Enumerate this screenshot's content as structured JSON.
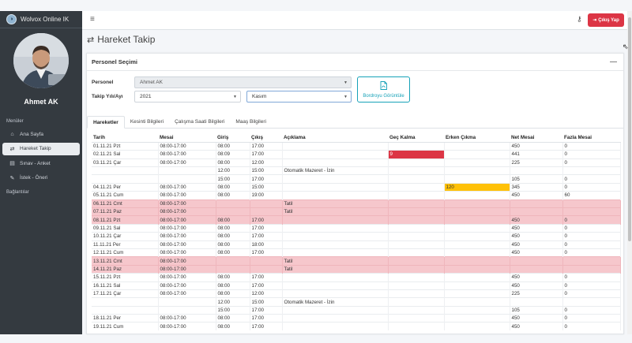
{
  "brand": {
    "name": "Wolvox Online IK"
  },
  "user": {
    "name": "Ahmet AK"
  },
  "sidebar": {
    "menu_label": "Menüler",
    "items": [
      {
        "label": "Ana Sayfa",
        "icon": "home-icon"
      },
      {
        "label": "Hareket Takip",
        "icon": "exchange-icon"
      },
      {
        "label": "Sınav - Anket",
        "icon": "list-icon"
      },
      {
        "label": "İstek - Öneri",
        "icon": "edit-icon"
      }
    ],
    "links_label": "Bağlantılar"
  },
  "topbar": {
    "logout_label": "Çıkış Yap"
  },
  "page": {
    "title": "Hareket Takip"
  },
  "card": {
    "title": "Personel Seçimi",
    "personel_label": "Personel",
    "personel_value": "Ahmet AK",
    "period_label": "Takip Yılı/Ayı",
    "year_value": "2021",
    "month_value": "Kasım",
    "bordro_label": "Bordroyu Görüntüle"
  },
  "tabs": [
    "Hareketler",
    "Kesinti Bilgileri",
    "Çalışma Saati Bilgileri",
    "Maaş Bilgileri"
  ],
  "table": {
    "headers": [
      "Tarih",
      "Mesai",
      "Giriş",
      "Çıkış",
      "Açıklama",
      "Geç Kalma",
      "Erken Çıkma",
      "Net Mesai",
      "Fazla Mesai"
    ],
    "rows": [
      [
        "01.11.21 Pzt",
        "08:00-17:00",
        "08:00",
        "17:00",
        "",
        "",
        "",
        "450",
        "0"
      ],
      [
        "02.11.21 Sal",
        "08:00-17:00",
        "08:09",
        "17:00",
        "",
        "9",
        "",
        "441",
        "0"
      ],
      [
        "03.11.21 Çar",
        "08:00-17:00",
        "08:00",
        "12:00",
        "",
        "",
        "",
        "225",
        "0"
      ],
      [
        "",
        "",
        "12:00",
        "15:00",
        "Otomatik Mazeret - İzin",
        "",
        "",
        "",
        ""
      ],
      [
        "",
        "",
        "15:00",
        "17:00",
        "",
        "",
        "",
        "105",
        "0"
      ],
      [
        "04.11.21 Per",
        "08:00-17:00",
        "08:00",
        "15:00",
        "",
        "",
        "120",
        "345",
        "0"
      ],
      [
        "05.11.21 Cum",
        "08:00-17:00",
        "08:00",
        "19:00",
        "",
        "",
        "",
        "450",
        "60"
      ],
      [
        "06.11.21 Cmt",
        "08:00-17:00",
        "",
        "",
        "Tatil",
        "",
        "",
        "",
        ""
      ],
      [
        "07.11.21 Paz",
        "08:00-17:00",
        "",
        "",
        "Tatil",
        "",
        "",
        "",
        ""
      ],
      [
        "08.11.21 Pzt",
        "08:00-17:00",
        "08:00",
        "17:00",
        "",
        "",
        "",
        "450",
        "0"
      ],
      [
        "09.11.21 Sal",
        "08:00-17:00",
        "08:00",
        "17:00",
        "",
        "",
        "",
        "450",
        "0"
      ],
      [
        "10.11.21 Çar",
        "08:00-17:00",
        "08:00",
        "17:00",
        "",
        "",
        "",
        "450",
        "0"
      ],
      [
        "11.11.21 Per",
        "08:00-17:00",
        "08:00",
        "18:00",
        "",
        "",
        "",
        "450",
        "0"
      ],
      [
        "12.11.21 Cum",
        "08:00-17:00",
        "08:00",
        "17:00",
        "",
        "",
        "",
        "450",
        "0"
      ],
      [
        "13.11.21 Cmt",
        "08:00-17:00",
        "",
        "",
        "Tatil",
        "",
        "",
        "",
        ""
      ],
      [
        "14.11.21 Paz",
        "08:00-17:00",
        "",
        "",
        "Tatil",
        "",
        "",
        "",
        ""
      ],
      [
        "15.11.21 Pzt",
        "08:00-17:00",
        "08:00",
        "17:00",
        "",
        "",
        "",
        "450",
        "0"
      ],
      [
        "16.11.21 Sal",
        "08:00-17:00",
        "08:00",
        "17:00",
        "",
        "",
        "",
        "450",
        "0"
      ],
      [
        "17.11.21 Çar",
        "08:00-17:00",
        "08:00",
        "12:00",
        "",
        "",
        "",
        "225",
        "0"
      ],
      [
        "",
        "",
        "12:00",
        "15:00",
        "Otomatik Mazeret - İzin",
        "",
        "",
        "",
        ""
      ],
      [
        "",
        "",
        "15:00",
        "17:00",
        "",
        "",
        "",
        "105",
        "0"
      ],
      [
        "18.11.21 Per",
        "08:00-17:00",
        "08:00",
        "17:00",
        "",
        "",
        "",
        "450",
        "0"
      ],
      [
        "19.11.21 Cum",
        "08:00-17:00",
        "08:00",
        "17:00",
        "",
        "",
        "",
        "450",
        "0"
      ]
    ],
    "holiday_rows": [
      7,
      8,
      9,
      14,
      15
    ],
    "late_cells": [
      [
        1,
        5
      ]
    ],
    "early_cells": [
      [
        5,
        6
      ]
    ]
  },
  "colors": {
    "sidebar_bg": "#343a40",
    "logout": "#dc3545",
    "holiday_row": "#f6c7cc",
    "late": "#dc3545",
    "early": "#ffc107",
    "accent": "#17a2b8"
  }
}
